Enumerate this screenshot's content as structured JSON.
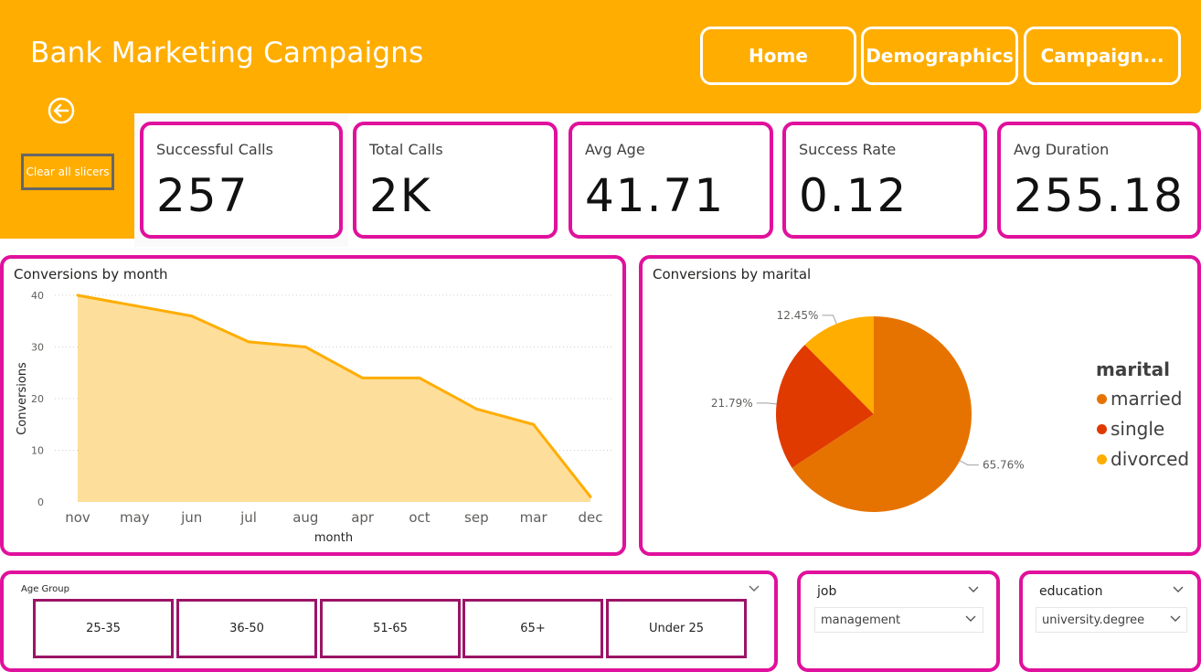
{
  "header": {
    "title": "Bank Marketing Campaigns",
    "nav": [
      "Home",
      "Demographics",
      "Campaign..."
    ]
  },
  "sidebar": {
    "back_icon": "back-arrow-icon",
    "clear_label": "Clear all slicers"
  },
  "kpis": [
    {
      "label": "Successful Calls",
      "value": "257"
    },
    {
      "label": "Total Calls",
      "value": "2K"
    },
    {
      "label": "Avg Age",
      "value": "41.71"
    },
    {
      "label": "Success Rate",
      "value": "0.12"
    },
    {
      "label": "Avg Duration",
      "value": "255.18"
    }
  ],
  "colors": {
    "header": "#FFAD01",
    "card_border": "#E0119C",
    "chip_border": "#9B1466",
    "area_line": "#FFAD01",
    "area_fill": "#FDDE9B",
    "married": "#E67300",
    "single": "#E03A00",
    "divorced": "#FFAD01"
  },
  "chart_data": [
    {
      "type": "area",
      "title": "Conversions by month",
      "xlabel": "month",
      "ylabel": "Conversions",
      "categories": [
        "nov",
        "may",
        "jun",
        "jul",
        "aug",
        "apr",
        "oct",
        "sep",
        "mar",
        "dec"
      ],
      "values": [
        40,
        38,
        36,
        31,
        30,
        24,
        24,
        18,
        15,
        1
      ],
      "ylim": [
        0,
        40
      ],
      "yticks": [
        0,
        10,
        20,
        30,
        40
      ],
      "grid": true
    },
    {
      "type": "pie",
      "title": "Conversions by marital",
      "legend_title": "marital",
      "legend_position": "right",
      "slices": [
        {
          "name": "married",
          "percent": 65.76,
          "label": "65.76%"
        },
        {
          "name": "single",
          "percent": 21.79,
          "label": "21.79%"
        },
        {
          "name": "divorced",
          "percent": 12.45,
          "label": "12.45%"
        }
      ]
    }
  ],
  "slicers": {
    "age_group": {
      "label": "Age Group",
      "options": [
        "25-35",
        "36-50",
        "51-65",
        "65+",
        "Under 25"
      ]
    },
    "job": {
      "label": "job",
      "selected": "management"
    },
    "education": {
      "label": "education",
      "selected": "university.degree"
    }
  }
}
